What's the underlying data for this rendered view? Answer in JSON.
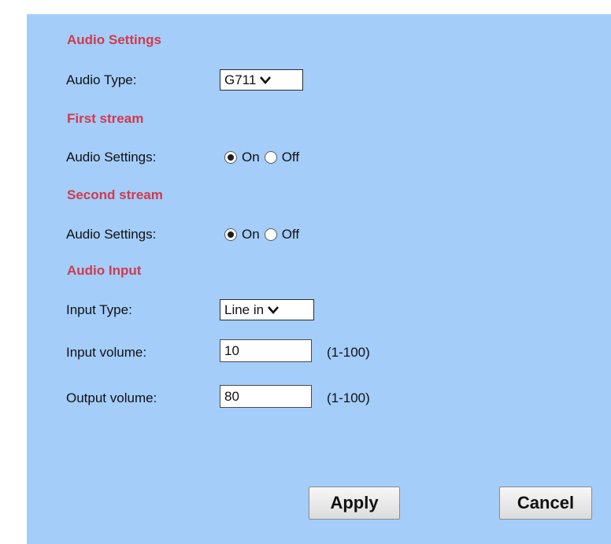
{
  "audio_settings": {
    "heading": "Audio Settings",
    "audio_type_label": "Audio Type:",
    "audio_type_value": "G711"
  },
  "first_stream": {
    "heading": "First stream",
    "setting_label": "Audio Settings:",
    "on_label": "On",
    "off_label": "Off",
    "selected": "On"
  },
  "second_stream": {
    "heading": "Second stream",
    "setting_label": "Audio Settings:",
    "on_label": "On",
    "off_label": "Off",
    "selected": "On"
  },
  "audio_input": {
    "heading": "Audio Input",
    "input_type_label": "Input Type:",
    "input_type_value": "Line in",
    "input_volume_label": "Input volume:",
    "input_volume_value": "10",
    "input_volume_range": "(1-100)",
    "output_volume_label": "Output volume:",
    "output_volume_value": "80",
    "output_volume_range": "(1-100)"
  },
  "buttons": {
    "apply": "Apply",
    "cancel": "Cancel"
  },
  "colors": {
    "panel_background": "#a4cdf9",
    "section_heading": "#d13a4b"
  }
}
